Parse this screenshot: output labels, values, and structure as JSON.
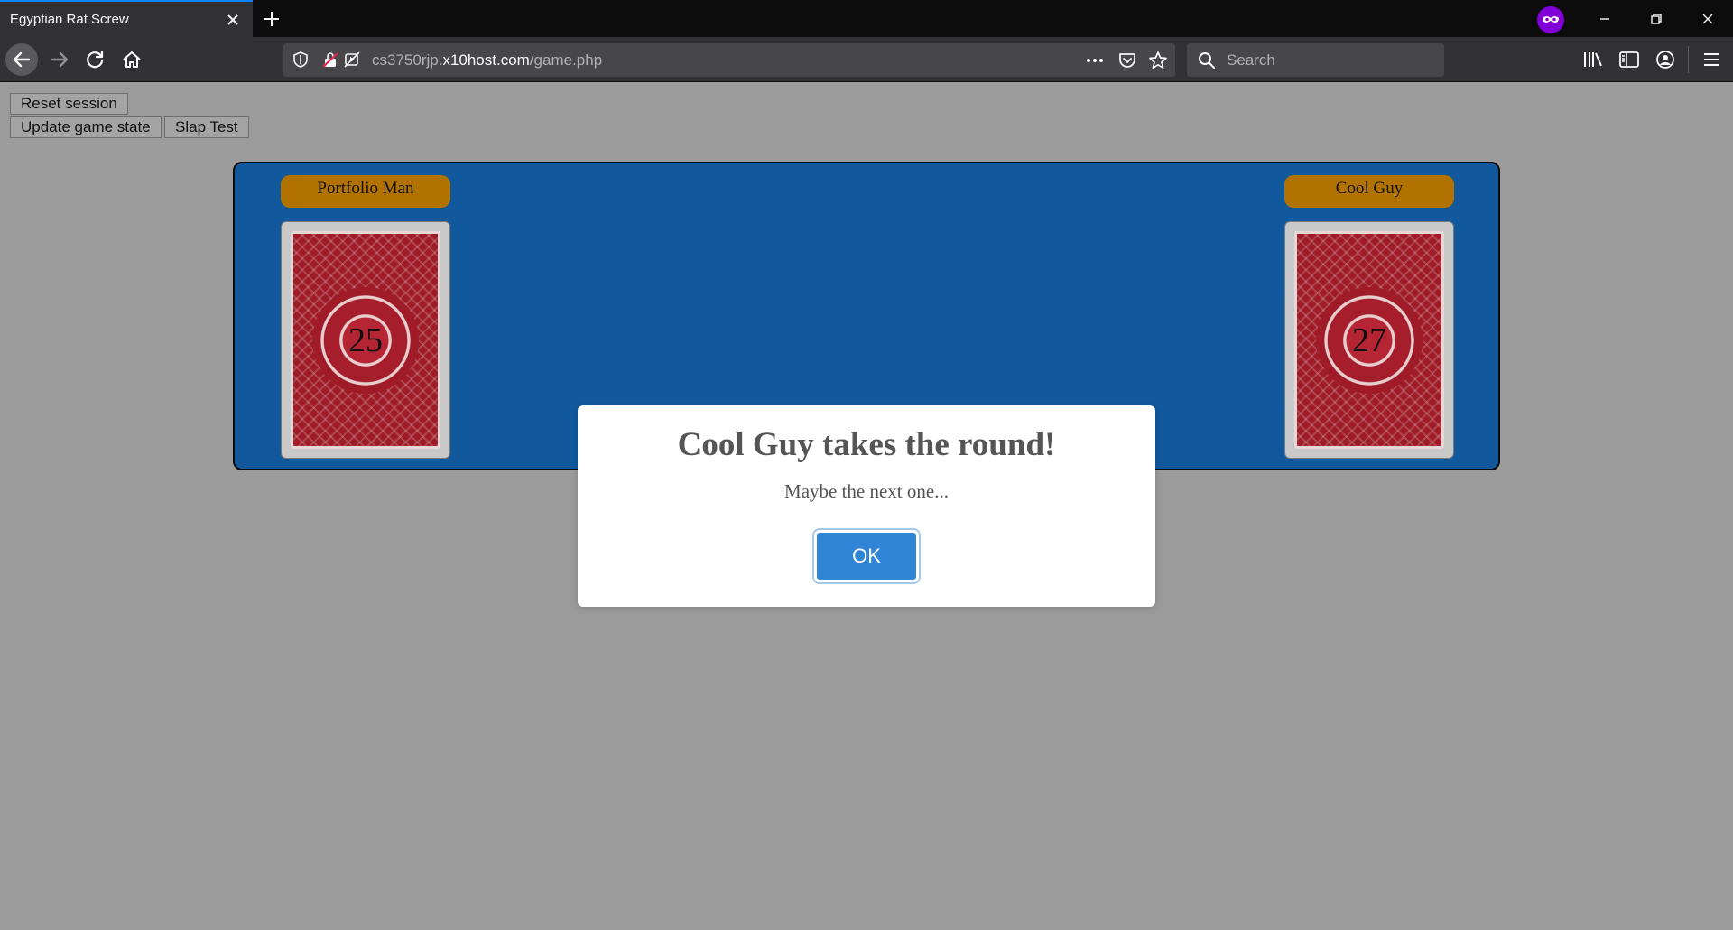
{
  "browser": {
    "tab_title": "Egyptian Rat Screw",
    "url_prefix": "cs3750rjp.",
    "url_host": "x10host.com",
    "url_path": "/game.php",
    "search_placeholder": "Search"
  },
  "controls": {
    "reset_label": "Reset session",
    "update_label": "Update game state",
    "slap_label": "Slap Test"
  },
  "players": [
    {
      "name": "Portfolio Man",
      "card_count": "25"
    },
    {
      "name": "Cool Guy",
      "card_count": "27"
    }
  ],
  "modal": {
    "title": "Cool Guy takes the round!",
    "text": "Maybe the next one...",
    "ok_label": "OK"
  },
  "colors": {
    "board": "#11589d",
    "label": "#b27200",
    "card_back": "#9e1b27",
    "ok_button": "#3085d6",
    "private_badge": "#8000d7"
  }
}
